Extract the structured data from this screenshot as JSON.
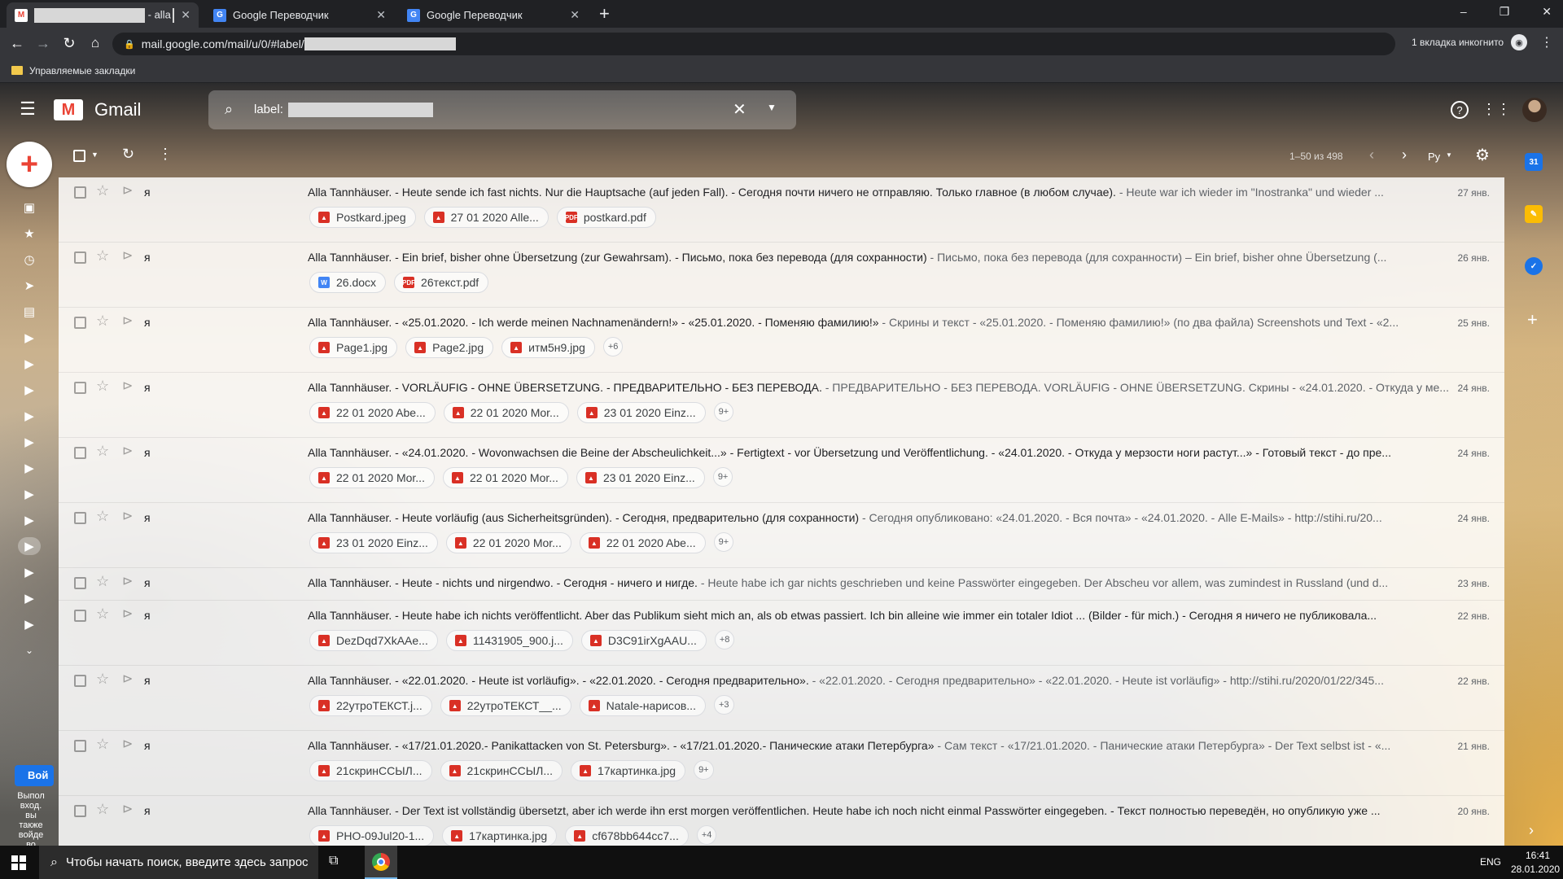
{
  "browser": {
    "tabs": [
      {
        "title": "- alla",
        "redacted": true,
        "active": true,
        "favicon": "gmail-icon"
      },
      {
        "title": "Google Переводчик",
        "active": false,
        "favicon": "translate-icon"
      },
      {
        "title": "Google Переводчик",
        "active": false,
        "favicon": "translate-icon"
      }
    ],
    "new_tab_label": "+",
    "url": "mail.google.com/mail/u/0/#label/",
    "incognito_label": "1 вкладка инкогнито",
    "bookmarks_folder": "Управляемые закладки"
  },
  "gmail": {
    "product_name": "Gmail",
    "search_value": "label:",
    "pagination": "1–50 из 498",
    "lang_button": "Ру",
    "chat_promo_button": "Вой",
    "chat_promo_text": "Выпол вход. вы также войде во"
  },
  "emails": [
    {
      "sender": "я",
      "subject": "Alla Tannhäuser. - Heute sende ich fast nichts. Nur die Hauptsache (auf jeden Fall). - Сегодня почти ничего не отправляю. Только главное (в любом случае).",
      "snippet": " - Heute war ich wieder im \"Inostranka\" und wieder ...",
      "date": "27 янв.",
      "attachments": [
        {
          "name": "Postkard.jpeg",
          "type": "image"
        },
        {
          "name": "27 01 2020 Alle...",
          "type": "image"
        },
        {
          "name": "postkard.pdf",
          "type": "pdf"
        }
      ],
      "more": ""
    },
    {
      "sender": "я",
      "subject": "Alla Tannhäuser. - Ein brief, bisher ohne Übersetzung (zur Gewahrsam). - Письмо, пока без перевода (для сохранности)",
      "snippet": " - Письмо, пока без перевода (для сохранности) – Ein brief, bisher ohne Übersetzung (...",
      "date": "26 янв.",
      "attachments": [
        {
          "name": "26.docx",
          "type": "word"
        },
        {
          "name": "26текст.pdf",
          "type": "pdf"
        }
      ],
      "more": ""
    },
    {
      "sender": "я",
      "subject": "Alla Tannhäuser. - «25.01.2020. - Ich werde meinen Nachnamenändern!» - «25.01.2020. - Поменяю фамилию!»",
      "snippet": " - Скрины и текст - «25.01.2020. - Поменяю фамилию!» (по два файла) Screenshots und Text - «2...",
      "date": "25 янв.",
      "attachments": [
        {
          "name": "Page1.jpg",
          "type": "image"
        },
        {
          "name": "Page2.jpg",
          "type": "image"
        },
        {
          "name": "итм5н9.jpg",
          "type": "image"
        }
      ],
      "more": "+6"
    },
    {
      "sender": "я",
      "subject": "Alla Tannhäuser. - VORLÄUFIG - OHNE ÜBERSETZUNG. - ПРЕДВАРИТЕЛЬНО - БЕЗ ПЕРЕВОДА.",
      "snippet": " - ПРЕДВАРИТЕЛЬНО - БЕЗ ПЕРЕВОДА. VORLÄUFIG - OHNE ÜBERSETZUNG. Скрины - «24.01.2020. - Откуда у ме...",
      "date": "24 янв.",
      "attachments": [
        {
          "name": "22 01 2020 Abe...",
          "type": "image"
        },
        {
          "name": "22 01 2020 Mor...",
          "type": "image"
        },
        {
          "name": "23 01 2020 Einz...",
          "type": "image"
        }
      ],
      "more": "9+"
    },
    {
      "sender": "я",
      "subject": "Alla Tannhäuser. - «24.01.2020. - Wovonwachsen die Beine der Abscheulichkeit...» - Fertigtext - vor Übersetzung und Veröffentlichung. - «24.01.2020. - Откуда у мерзости ноги растут...» - Готовый текст - до пре...",
      "snippet": "",
      "date": "24 янв.",
      "attachments": [
        {
          "name": "22 01 2020 Mor...",
          "type": "image"
        },
        {
          "name": "22 01 2020 Mor...",
          "type": "image"
        },
        {
          "name": "23 01 2020 Einz...",
          "type": "image"
        }
      ],
      "more": "9+"
    },
    {
      "sender": "я",
      "subject": "Alla Tannhäuser. - Heute vorläufig (aus Sicherheitsgründen). - Сегодня, предварительно (для сохранности)",
      "snippet": " - Сегодня опубликовано: «24.01.2020. - Вся почта» - «24.01.2020. - Alle E-Mails» - http://stihi.ru/20...",
      "date": "24 янв.",
      "attachments": [
        {
          "name": "23 01 2020 Einz...",
          "type": "image"
        },
        {
          "name": "22 01 2020 Mor...",
          "type": "image"
        },
        {
          "name": "22 01 2020 Abe...",
          "type": "image"
        }
      ],
      "more": "9+"
    },
    {
      "sender": "я",
      "subject": "Alla Tannhäuser. - Heute - nichts und nirgendwo. - Сегодня - ничего и нигде.",
      "snippet": " - Heute habe ich gar nichts geschrieben und keine Passwörter eingegeben. Der Abscheu vor allem, was zumindest in Russland (und d...",
      "date": "23 янв.",
      "attachments": [],
      "more": ""
    },
    {
      "sender": "я",
      "subject": "Alla Tannhäuser. - Heute habe ich nichts veröffentlicht. Aber das Publikum sieht mich an, als ob etwas passiert. Ich bin alleine wie immer ein totaler Idiot ... (Bilder - für mich.) - Сегодня я ничего не публиковала...",
      "snippet": "",
      "date": "22 янв.",
      "attachments": [
        {
          "name": "DezDqd7XkAAe...",
          "type": "image"
        },
        {
          "name": "11431905_900.j...",
          "type": "image"
        },
        {
          "name": "D3C91irXgAAU...",
          "type": "image"
        }
      ],
      "more": "+8"
    },
    {
      "sender": "я",
      "subject": "Alla Tannhäuser. - «22.01.2020. - Heute ist vorläufig». - «22.01.2020. - Сегодня предварительно».",
      "snippet": " - «22.01.2020. - Сегодня предварительно» - «22.01.2020. - Heute ist vorläufig» - http://stihi.ru/2020/01/22/345...",
      "date": "22 янв.",
      "attachments": [
        {
          "name": "22утроТЕКСТ.j...",
          "type": "image"
        },
        {
          "name": "22утроТЕКСТ__...",
          "type": "image"
        },
        {
          "name": "Natale-нарисов...",
          "type": "image"
        }
      ],
      "more": "+3"
    },
    {
      "sender": "я",
      "subject": "Alla Tannhäuser. - «17/21.01.2020.- Panikattacken von St. Petersburg». - «17/21.01.2020.- Панические атаки Петербурга»",
      "snippet": " - Сам текст - «17/21.01.2020. - Панические атаки Петербурга» - Der Text selbst ist - «...",
      "date": "21 янв.",
      "attachments": [
        {
          "name": "21скринССЫЛ...",
          "type": "image"
        },
        {
          "name": "21скринССЫЛ...",
          "type": "image"
        },
        {
          "name": "17картинка.jpg",
          "type": "image"
        }
      ],
      "more": "9+"
    },
    {
      "sender": "я",
      "subject": "Alla Tannhäuser. - Der Text ist vollständig übersetzt, aber ich werde ihn erst morgen veröffentlichen. Heute habe ich noch nicht einmal Passwörter eingegeben. - Текст полностью переведён, но опубликую уже ...",
      "snippet": "",
      "date": "20 янв.",
      "attachments": [
        {
          "name": "PHO-09Jul20-1...",
          "type": "image"
        },
        {
          "name": "17картинка.jpg",
          "type": "image"
        },
        {
          "name": "cf678bb644cc7...",
          "type": "image"
        }
      ],
      "more": "+4"
    }
  ],
  "taskbar": {
    "search_placeholder": "Чтобы начать поиск, введите здесь запрос",
    "lang": "ENG",
    "time": "16:41",
    "date": "28.01.2020"
  },
  "colors": {
    "gmail_red": "#ea4335",
    "pdf_red": "#d93025",
    "word_blue": "#4285f4"
  }
}
